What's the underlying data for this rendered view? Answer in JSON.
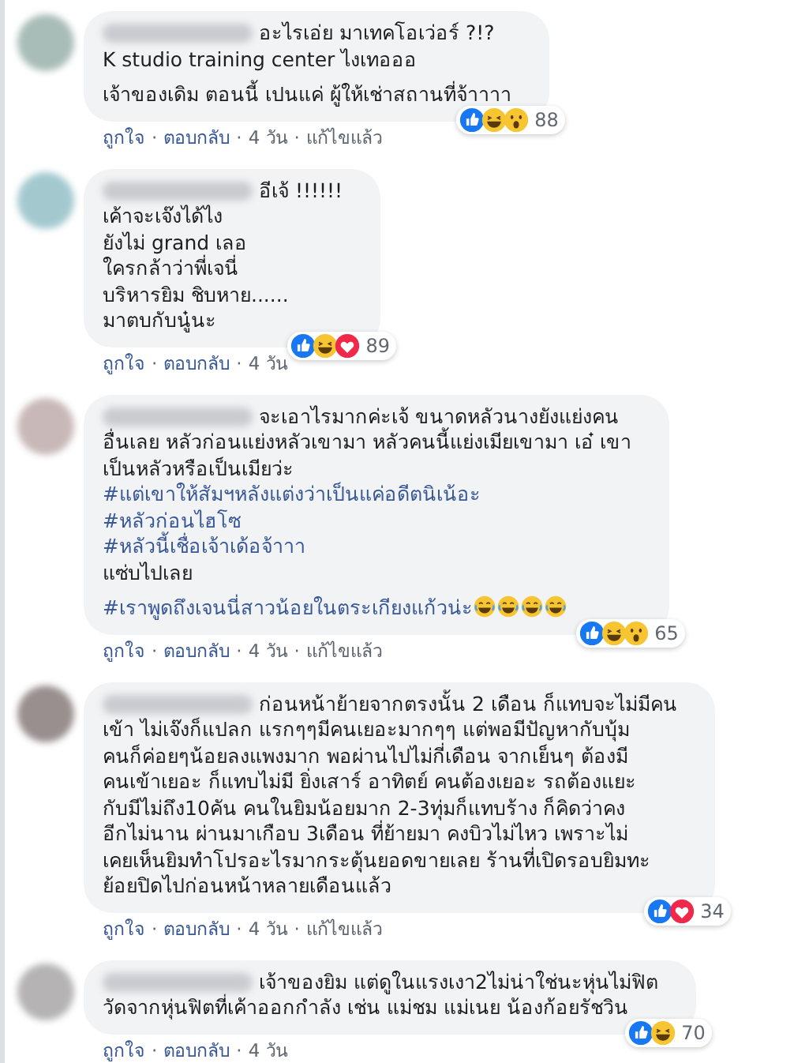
{
  "comments": [
    {
      "avatar": {
        "color": "#a9bdb8"
      },
      "lead": "อะไรเอ่ย มาเทคโอเว่อร์ ?!?",
      "paragraphs": [
        {
          "kind": "text",
          "text": "K studio training center ไงเทอออ"
        },
        {
          "kind": "text",
          "gap_before": true,
          "text": "เจ้าของเดิม ตอนนี้ เปนแค่ ผู้ให้เช่าสถานที่จ้าาาา"
        }
      ],
      "reactions": {
        "icons": [
          {
            "kind": "like"
          },
          {
            "kind": "haha"
          },
          {
            "kind": "wow"
          }
        ],
        "count": "88"
      },
      "meta": [
        {
          "kind": "link",
          "text": "ถูกใจ"
        },
        {
          "kind": "dot",
          "text": "·"
        },
        {
          "kind": "link",
          "text": "ตอบกลับ"
        },
        {
          "kind": "dot",
          "text": "·"
        },
        {
          "kind": "text",
          "text": "4 วัน"
        },
        {
          "kind": "dot",
          "text": "·"
        },
        {
          "kind": "text",
          "text": "แก้ไขแล้ว"
        }
      ]
    },
    {
      "avatar": {
        "color": "#a3c9cf"
      },
      "lead": "อีเจ้ !!!!!!",
      "paragraphs": [
        {
          "kind": "text",
          "text": "เค้าจะเจ๊งได้ไง\nยังไม่ grand เลอ\nใครกล้าว่าพี่เจนี่\nบริหารยิม ชิบหาย......\nมาตบกับนู๋นะ"
        }
      ],
      "reactions": {
        "icons": [
          {
            "kind": "like"
          },
          {
            "kind": "haha"
          },
          {
            "kind": "love"
          }
        ],
        "count": "89"
      },
      "meta": [
        {
          "kind": "link",
          "text": "ถูกใจ"
        },
        {
          "kind": "dot",
          "text": "·"
        },
        {
          "kind": "link",
          "text": "ตอบกลับ"
        },
        {
          "kind": "dot",
          "text": "·"
        },
        {
          "kind": "text",
          "text": "4 วัน"
        }
      ]
    },
    {
      "avatar": {
        "color": "#c9b8b8"
      },
      "lead": "จะเอาไรมากค่ะเจ้ ขนาดหลัวนางยังแย่งคน",
      "paragraphs": [
        {
          "kind": "text",
          "text": "อื่นเลย หลัวก่อนแย่งหลัวเขามา หลัวคนนี้แย่งเมียเขามา เอ๋ เขา\nเป็นหลัวหรือเป็นเมียว่ะ"
        },
        {
          "kind": "hashtag",
          "text": "#แต่เขาให้สัมฯหลังแต่งว่าเป็นแค่อดีตนิเน้อะ"
        },
        {
          "kind": "hashtag",
          "text": "#หลัวก่อนไฮโซ"
        },
        {
          "kind": "hashtag",
          "text": "#หลัวนี้เชื่อเจ้าเด้อจ้าาา"
        },
        {
          "kind": "text",
          "text": "แซ่บไปเลย"
        },
        {
          "kind": "hashtag",
          "gap_before": true,
          "text": "#เราพูดถึงเจนนี่สาวน้อยในตระเกียงแก้วน่ะ",
          "emoji": [
            {
              "kind": "laugh"
            },
            {
              "kind": "laugh"
            },
            {
              "kind": "laugh"
            },
            {
              "kind": "laugh"
            }
          ]
        }
      ],
      "reactions": {
        "icons": [
          {
            "kind": "like"
          },
          {
            "kind": "haha"
          },
          {
            "kind": "wow"
          }
        ],
        "count": "65"
      },
      "meta": [
        {
          "kind": "link",
          "text": "ถูกใจ"
        },
        {
          "kind": "dot",
          "text": "·"
        },
        {
          "kind": "link",
          "text": "ตอบกลับ"
        },
        {
          "kind": "dot",
          "text": "·"
        },
        {
          "kind": "text",
          "text": "4 วัน"
        },
        {
          "kind": "dot",
          "text": "·"
        },
        {
          "kind": "text",
          "text": "แก้ไขแล้ว"
        }
      ]
    },
    {
      "avatar": {
        "color": "#9a8f8f"
      },
      "lead": "ก่อนหน้าย้ายจากตรงนั้น 2 เดือน ก็แทบจะไม่มีคน",
      "paragraphs": [
        {
          "kind": "text",
          "text": "เข้า ไม่เจ๊งก็แปลก แรกๆๆมีคนเยอะมากๆๆ แต่พอมีปัญหากับบุ้ม\nคนก็ค่อยๆน้อยลงแพงมาก พอผ่านไปไม่กี่เดือน จากเย็นๆ ต้องมี\nคนเข้าเยอะ ก็แทบไม่มี ยิ่งเสาร์ อาทิตย์ คนต้องเยอะ รถต้องแยะ\nกับมีไม่ถึง10คัน คนในยิมน้อยมาก 2-3ทุ่มก็แทบร้าง ก็คิดว่าคง\nอีกไม่นาน ผ่านมาเกือบ 3เดือน ที่ย้ายมา คงบิวไม่ไหว เพราะไม่\nเคยเห็นยิมทำโปรอะไรมากระตุ้นยอดขายเลย ร้านที่เปิดรอบยิมทะ\nย้อยปิดไปก่อนหน้าหลายเดือนแล้ว"
        }
      ],
      "reactions": {
        "icons": [
          {
            "kind": "like"
          },
          {
            "kind": "love"
          }
        ],
        "count": "34"
      },
      "meta": [
        {
          "kind": "link",
          "text": "ถูกใจ"
        },
        {
          "kind": "dot",
          "text": "·"
        },
        {
          "kind": "link",
          "text": "ตอบกลับ"
        },
        {
          "kind": "dot",
          "text": "·"
        },
        {
          "kind": "text",
          "text": "4 วัน"
        },
        {
          "kind": "dot",
          "text": "·"
        },
        {
          "kind": "text",
          "text": "แก้ไขแล้ว"
        }
      ]
    },
    {
      "avatar": {
        "color": "#b5b3b3"
      },
      "lead": "เจ้าของยิม แต่ดูในแรงเงา2ไม่น่าใช่นะหุ่นไม่ฟิต",
      "paragraphs": [
        {
          "kind": "text",
          "text": "วัดจากหุ่นฟิตที่เค้าออกกำลัง เช่น แม่ชม แม่เนย น้องก้อยรัชวิน"
        }
      ],
      "reactions": {
        "icons": [
          {
            "kind": "like"
          },
          {
            "kind": "haha"
          }
        ],
        "count": "70"
      },
      "meta": [
        {
          "kind": "link",
          "text": "ถูกใจ"
        },
        {
          "kind": "dot",
          "text": "·"
        },
        {
          "kind": "link",
          "text": "ตอบกลับ"
        },
        {
          "kind": "dot",
          "text": "·"
        },
        {
          "kind": "text",
          "text": "4 วัน"
        }
      ]
    }
  ]
}
